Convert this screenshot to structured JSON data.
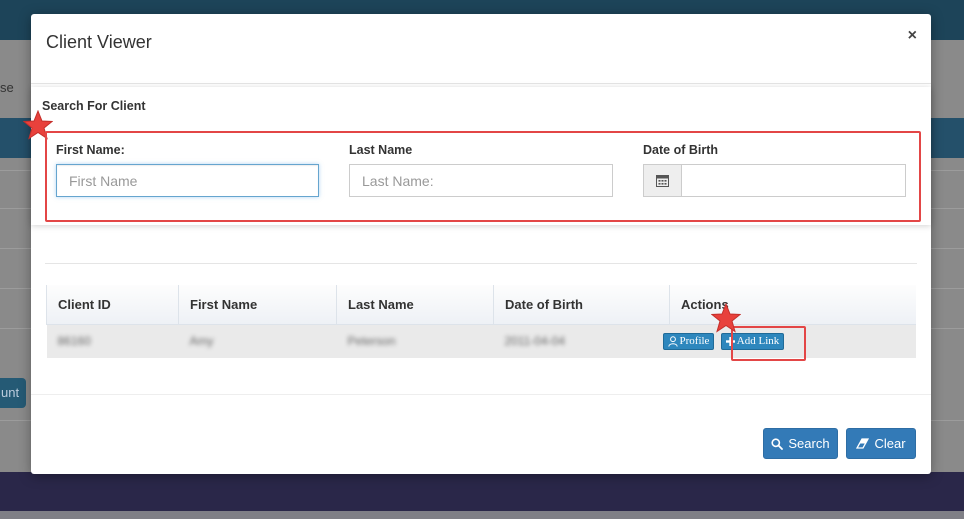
{
  "background": {
    "left_text": "se",
    "left_button": "unt"
  },
  "modal": {
    "title": "Client Viewer",
    "close": "×"
  },
  "search": {
    "heading": "Search For Client",
    "first_name": {
      "label": "First Name:",
      "placeholder": "First Name",
      "value": ""
    },
    "last_name": {
      "label": "Last Name",
      "placeholder": "Last Name:",
      "value": ""
    },
    "dob": {
      "label": "Date of Birth",
      "value": "",
      "icon": "calendar-icon"
    }
  },
  "table": {
    "headers": [
      "Client ID",
      "First Name",
      "Last Name",
      "Date of Birth",
      "Actions"
    ],
    "rows": [
      {
        "client_id": "86160",
        "first_name": "Amy",
        "last_name": "Peterson",
        "dob": "2011-04-04"
      }
    ],
    "actions": {
      "profile": "Profile",
      "add_link": "Add Link"
    }
  },
  "footer": {
    "search_button": "Search",
    "clear_button": "Clear"
  },
  "colors": {
    "primary": "#337ab7",
    "highlight": "#e34646",
    "star": "#e8413c"
  }
}
